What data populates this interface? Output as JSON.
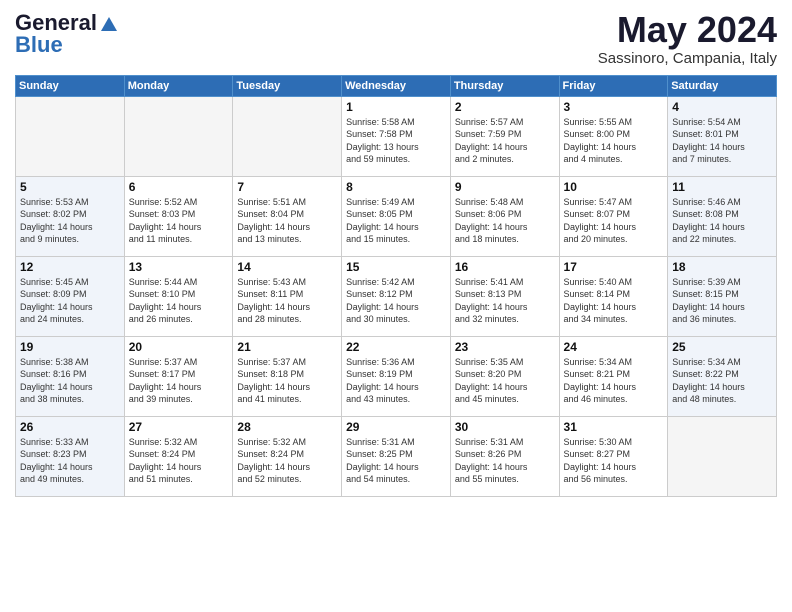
{
  "logo": {
    "general": "General",
    "blue": "Blue"
  },
  "title": "May 2024",
  "subtitle": "Sassinoro, Campania, Italy",
  "days_header": [
    "Sunday",
    "Monday",
    "Tuesday",
    "Wednesday",
    "Thursday",
    "Friday",
    "Saturday"
  ],
  "weeks": [
    [
      {
        "num": "",
        "info": ""
      },
      {
        "num": "",
        "info": ""
      },
      {
        "num": "",
        "info": ""
      },
      {
        "num": "1",
        "info": "Sunrise: 5:58 AM\nSunset: 7:58 PM\nDaylight: 13 hours\nand 59 minutes."
      },
      {
        "num": "2",
        "info": "Sunrise: 5:57 AM\nSunset: 7:59 PM\nDaylight: 14 hours\nand 2 minutes."
      },
      {
        "num": "3",
        "info": "Sunrise: 5:55 AM\nSunset: 8:00 PM\nDaylight: 14 hours\nand 4 minutes."
      },
      {
        "num": "4",
        "info": "Sunrise: 5:54 AM\nSunset: 8:01 PM\nDaylight: 14 hours\nand 7 minutes."
      }
    ],
    [
      {
        "num": "5",
        "info": "Sunrise: 5:53 AM\nSunset: 8:02 PM\nDaylight: 14 hours\nand 9 minutes."
      },
      {
        "num": "6",
        "info": "Sunrise: 5:52 AM\nSunset: 8:03 PM\nDaylight: 14 hours\nand 11 minutes."
      },
      {
        "num": "7",
        "info": "Sunrise: 5:51 AM\nSunset: 8:04 PM\nDaylight: 14 hours\nand 13 minutes."
      },
      {
        "num": "8",
        "info": "Sunrise: 5:49 AM\nSunset: 8:05 PM\nDaylight: 14 hours\nand 15 minutes."
      },
      {
        "num": "9",
        "info": "Sunrise: 5:48 AM\nSunset: 8:06 PM\nDaylight: 14 hours\nand 18 minutes."
      },
      {
        "num": "10",
        "info": "Sunrise: 5:47 AM\nSunset: 8:07 PM\nDaylight: 14 hours\nand 20 minutes."
      },
      {
        "num": "11",
        "info": "Sunrise: 5:46 AM\nSunset: 8:08 PM\nDaylight: 14 hours\nand 22 minutes."
      }
    ],
    [
      {
        "num": "12",
        "info": "Sunrise: 5:45 AM\nSunset: 8:09 PM\nDaylight: 14 hours\nand 24 minutes."
      },
      {
        "num": "13",
        "info": "Sunrise: 5:44 AM\nSunset: 8:10 PM\nDaylight: 14 hours\nand 26 minutes."
      },
      {
        "num": "14",
        "info": "Sunrise: 5:43 AM\nSunset: 8:11 PM\nDaylight: 14 hours\nand 28 minutes."
      },
      {
        "num": "15",
        "info": "Sunrise: 5:42 AM\nSunset: 8:12 PM\nDaylight: 14 hours\nand 30 minutes."
      },
      {
        "num": "16",
        "info": "Sunrise: 5:41 AM\nSunset: 8:13 PM\nDaylight: 14 hours\nand 32 minutes."
      },
      {
        "num": "17",
        "info": "Sunrise: 5:40 AM\nSunset: 8:14 PM\nDaylight: 14 hours\nand 34 minutes."
      },
      {
        "num": "18",
        "info": "Sunrise: 5:39 AM\nSunset: 8:15 PM\nDaylight: 14 hours\nand 36 minutes."
      }
    ],
    [
      {
        "num": "19",
        "info": "Sunrise: 5:38 AM\nSunset: 8:16 PM\nDaylight: 14 hours\nand 38 minutes."
      },
      {
        "num": "20",
        "info": "Sunrise: 5:37 AM\nSunset: 8:17 PM\nDaylight: 14 hours\nand 39 minutes."
      },
      {
        "num": "21",
        "info": "Sunrise: 5:37 AM\nSunset: 8:18 PM\nDaylight: 14 hours\nand 41 minutes."
      },
      {
        "num": "22",
        "info": "Sunrise: 5:36 AM\nSunset: 8:19 PM\nDaylight: 14 hours\nand 43 minutes."
      },
      {
        "num": "23",
        "info": "Sunrise: 5:35 AM\nSunset: 8:20 PM\nDaylight: 14 hours\nand 45 minutes."
      },
      {
        "num": "24",
        "info": "Sunrise: 5:34 AM\nSunset: 8:21 PM\nDaylight: 14 hours\nand 46 minutes."
      },
      {
        "num": "25",
        "info": "Sunrise: 5:34 AM\nSunset: 8:22 PM\nDaylight: 14 hours\nand 48 minutes."
      }
    ],
    [
      {
        "num": "26",
        "info": "Sunrise: 5:33 AM\nSunset: 8:23 PM\nDaylight: 14 hours\nand 49 minutes."
      },
      {
        "num": "27",
        "info": "Sunrise: 5:32 AM\nSunset: 8:24 PM\nDaylight: 14 hours\nand 51 minutes."
      },
      {
        "num": "28",
        "info": "Sunrise: 5:32 AM\nSunset: 8:24 PM\nDaylight: 14 hours\nand 52 minutes."
      },
      {
        "num": "29",
        "info": "Sunrise: 5:31 AM\nSunset: 8:25 PM\nDaylight: 14 hours\nand 54 minutes."
      },
      {
        "num": "30",
        "info": "Sunrise: 5:31 AM\nSunset: 8:26 PM\nDaylight: 14 hours\nand 55 minutes."
      },
      {
        "num": "31",
        "info": "Sunrise: 5:30 AM\nSunset: 8:27 PM\nDaylight: 14 hours\nand 56 minutes."
      },
      {
        "num": "",
        "info": ""
      }
    ]
  ]
}
